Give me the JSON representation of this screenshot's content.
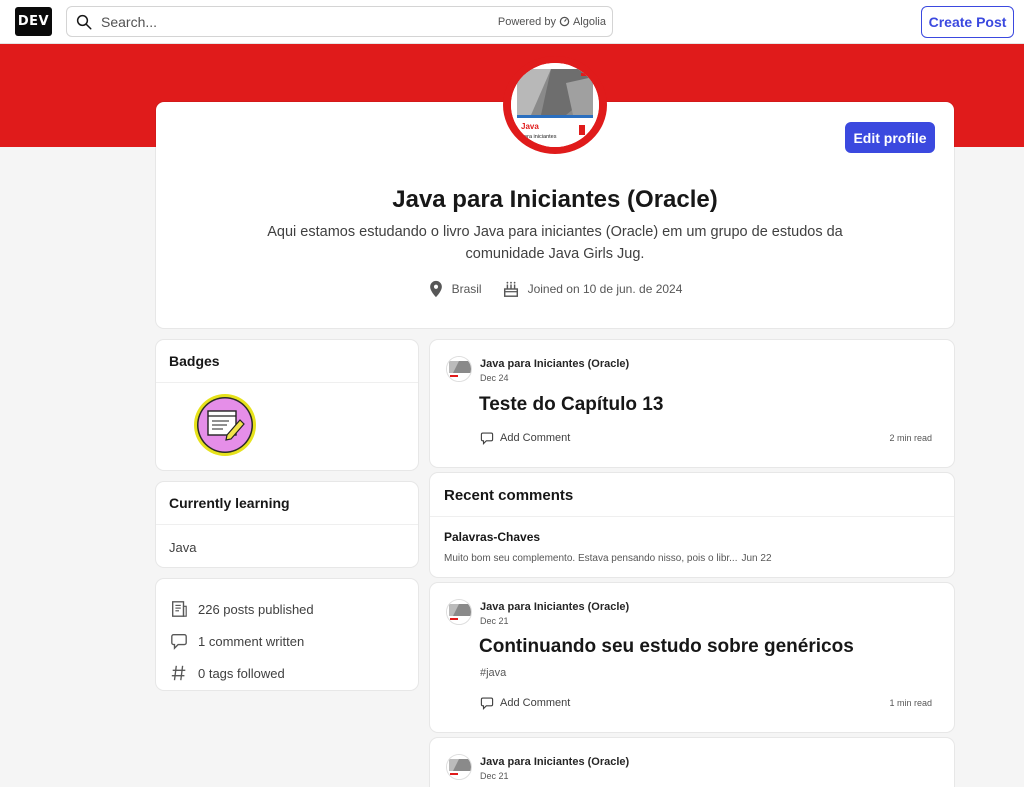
{
  "header": {
    "logo_text": "DEV",
    "search_placeholder": "Search...",
    "powered_by": "Powered by",
    "powered_brand": "Algolia",
    "create_post_label": "Create Post"
  },
  "colors": {
    "banner": "#e01b1b",
    "accent": "#3b49df"
  },
  "profile": {
    "edit_label": "Edit profile",
    "name": "Java para Iniciantes (Oracle)",
    "bio": "Aqui estamos estudando o livro Java para iniciantes (Oracle) em um grupo de estudos da comunidade Java Girls Jug.",
    "location": "Brasil",
    "joined": "Joined on 10 de jun. de 2024",
    "avatar_text_1": "Java",
    "avatar_text_2": "para iniciantes"
  },
  "sidebar": {
    "badges_title": "Badges",
    "learning_title": "Currently learning",
    "learning_value": "Java",
    "stats": [
      {
        "icon": "post-icon",
        "label": "226 posts published"
      },
      {
        "icon": "comment-icon",
        "label": "1 comment written"
      },
      {
        "icon": "hashtag-icon",
        "label": "0 tags followed"
      }
    ]
  },
  "posts": [
    {
      "author": "Java para Iniciantes (Oracle)",
      "date": "Dec 24",
      "title": "Teste do Capítulo 13",
      "tag": "",
      "comment_label": "Add Comment",
      "read_time": "2 min read"
    },
    {
      "author": "Java para Iniciantes (Oracle)",
      "date": "Dec 21",
      "title": "Continuando seu estudo sobre genéricos",
      "tag": "#java",
      "comment_label": "Add Comment",
      "read_time": "1 min read"
    },
    {
      "author": "Java para Iniciantes (Oracle)",
      "date": "Dec 21"
    }
  ],
  "recent_comments": {
    "title": "Recent comments",
    "items": [
      {
        "post_title": "Palavras-Chaves",
        "excerpt": "Muito bom seu complemento. Estava pensando nisso, pois o libr...",
        "date": "Jun 22"
      }
    ]
  }
}
